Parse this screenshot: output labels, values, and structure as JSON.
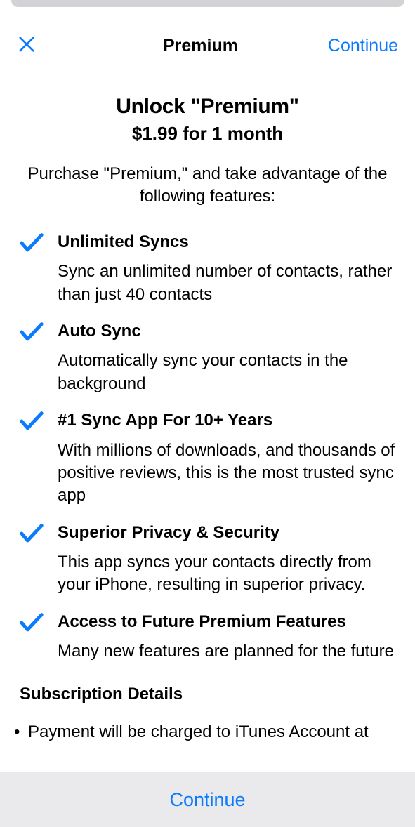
{
  "nav": {
    "title": "Premium",
    "continue_label": "Continue"
  },
  "hero": {
    "title": "Unlock \"Premium\"",
    "price_line": "$1.99 for 1 month",
    "description": "Purchase \"Premium,\" and take advantage of the following features:"
  },
  "features": [
    {
      "title": "Unlimited Syncs",
      "description": "Sync an unlimited number of contacts, rather than just 40 contacts"
    },
    {
      "title": "Auto Sync",
      "description": "Automatically sync your contacts in the background"
    },
    {
      "title": "#1 Sync App For 10+ Years",
      "description": "With millions of downloads, and thousands of positive reviews, this is the most trusted sync app"
    },
    {
      "title": "Superior Privacy & Security",
      "description": "This app syncs your contacts directly from your iPhone, resulting in superior privacy."
    },
    {
      "title": "Access to Future Premium Features",
      "description": "Many new features are planned for the future"
    }
  ],
  "details": {
    "header": "Subscription Details",
    "bullet_partial": "Payment will be charged to iTunes Account at"
  },
  "footer": {
    "continue_label": "Continue"
  },
  "colors": {
    "accent": "#0a7aff",
    "footer_bg": "#eaeaec"
  }
}
